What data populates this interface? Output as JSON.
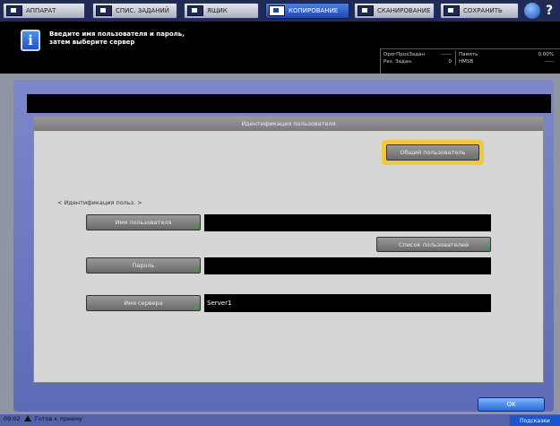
{
  "tabs": [
    {
      "label": "АППАРАТ"
    },
    {
      "label": "СПИС. ЗАДАНИЙ"
    },
    {
      "label": "ЯЩИК"
    },
    {
      "label": "КОПИРОВАНИЕ"
    },
    {
      "label": "СКАНИРОВАНИЕ"
    },
    {
      "label": "СОХРАНИТЬ"
    }
  ],
  "header": {
    "message_line1": "Введите имя пользователя и пароль,",
    "message_line2": "затем выберите сервер",
    "status": {
      "row1_left": "ОрогПрохЗадан",
      "row1_left_val": "------",
      "row1_right": "Память",
      "row1_right_val": "0.00%",
      "row2_left": "Рез. Задан.",
      "row2_left_val": "0",
      "row2_right": "HMSB",
      "row2_right_val": "-----"
    }
  },
  "panel": {
    "title": "Идентификация пользователя",
    "common_user_label": "Общий пользователь",
    "section_label": "< Идентификация польз. >",
    "username_btn": "Имя пользователя",
    "username_value": "",
    "user_list_btn": "Список пользователей",
    "password_btn": "Пароль",
    "password_value": "",
    "server_btn": "Имя сервера",
    "server_value": "Server1"
  },
  "footer": {
    "time": "09:02",
    "status": "Готов к приему",
    "right_label": "Подсказки",
    "ok_label": "OK"
  },
  "colors": {
    "highlight": "#f2c840",
    "active_tab": "#1f47b4",
    "panel_frame": "#6d7bc1"
  }
}
